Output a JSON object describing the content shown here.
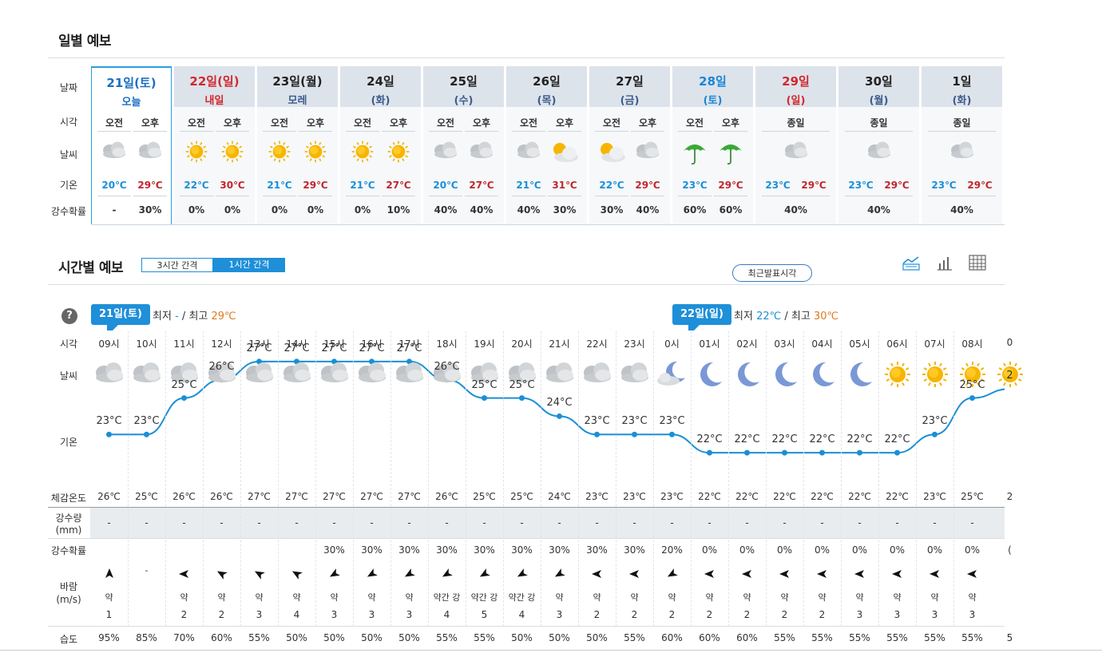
{
  "daily": {
    "title": "일별 예보",
    "labels": {
      "date": "날짜",
      "time": "시각",
      "weather": "날씨",
      "temp": "기온",
      "precip": "강수확률"
    },
    "am": "오전",
    "pm": "오후",
    "allday": "종일",
    "days": [
      {
        "name": "21일(토)",
        "sub": "오늘",
        "color": "#1a6fc4",
        "subcolor": "#1a6fc4",
        "split": true,
        "icons": [
          "cloud",
          "cloud"
        ],
        "lo": "20℃",
        "hi": "29℃",
        "p": [
          "-",
          "30%"
        ],
        "today": true
      },
      {
        "name": "22일(일)",
        "sub": "내일",
        "color": "#d2282e",
        "subcolor": "#d2282e",
        "split": true,
        "icons": [
          "sun",
          "sun"
        ],
        "lo": "22℃",
        "hi": "30℃",
        "p": [
          "0%",
          "0%"
        ]
      },
      {
        "name": "23일(월)",
        "sub": "모레",
        "color": "#222",
        "subcolor": "#3b5b8c",
        "split": true,
        "icons": [
          "sun",
          "sun"
        ],
        "lo": "21℃",
        "hi": "29℃",
        "p": [
          "0%",
          "0%"
        ]
      },
      {
        "name": "24일",
        "sub": "(화)",
        "color": "#222",
        "subcolor": "#3b5b8c",
        "split": true,
        "icons": [
          "sun",
          "sun"
        ],
        "lo": "21℃",
        "hi": "27℃",
        "p": [
          "0%",
          "10%"
        ]
      },
      {
        "name": "25일",
        "sub": "(수)",
        "color": "#222",
        "subcolor": "#3b5b8c",
        "split": true,
        "icons": [
          "cloud",
          "cloud"
        ],
        "lo": "20℃",
        "hi": "27℃",
        "p": [
          "40%",
          "40%"
        ]
      },
      {
        "name": "26일",
        "sub": "(목)",
        "color": "#222",
        "subcolor": "#3b5b8c",
        "split": true,
        "icons": [
          "cloud",
          "suncloud"
        ],
        "lo": "21℃",
        "hi": "31℃",
        "p": [
          "40%",
          "30%"
        ]
      },
      {
        "name": "27일",
        "sub": "(금)",
        "color": "#222",
        "subcolor": "#3b5b8c",
        "split": true,
        "icons": [
          "suncloud",
          "cloud"
        ],
        "lo": "22℃",
        "hi": "29℃",
        "p": [
          "30%",
          "40%"
        ]
      },
      {
        "name": "28일",
        "sub": "(토)",
        "color": "#1a86d6",
        "subcolor": "#1a86d6",
        "split": true,
        "icons": [
          "umbrella",
          "umbrella"
        ],
        "lo": "23℃",
        "hi": "29℃",
        "p": [
          "60%",
          "60%"
        ]
      },
      {
        "name": "29일",
        "sub": "(일)",
        "color": "#d2282e",
        "subcolor": "#d2282e",
        "split": false,
        "icons": [
          "cloud"
        ],
        "lo": "23℃",
        "hi": "29℃",
        "p": [
          "40%"
        ]
      },
      {
        "name": "30일",
        "sub": "(월)",
        "color": "#222",
        "subcolor": "#3b5b8c",
        "split": false,
        "icons": [
          "cloud"
        ],
        "lo": "23℃",
        "hi": "29℃",
        "p": [
          "40%"
        ]
      },
      {
        "name": "1일",
        "sub": "(화)",
        "color": "#222",
        "subcolor": "#3b5b8c",
        "split": false,
        "icons": [
          "cloud"
        ],
        "lo": "23℃",
        "hi": "29℃",
        "p": [
          "40%"
        ]
      }
    ]
  },
  "hourly": {
    "title": "시간별 예보",
    "interval3": "3시간 간격",
    "interval1": "1시간 간격",
    "latest": "최근발표시각",
    "help": "?",
    "labels": {
      "time": "시각",
      "weather": "날씨",
      "temp": "기온",
      "feel": "체감온도",
      "rain": "강수량",
      "rain_unit": "(mm)",
      "prob": "강수확률",
      "wind": "바람",
      "wind_unit": "(m/s)",
      "humid": "습도"
    },
    "day1": {
      "tag": "21일(토)",
      "min_label": "최저",
      "min": "-",
      "sep": "/",
      "max_label": "최고",
      "max": "29℃"
    },
    "day2": {
      "tag": "22일(일)",
      "min_label": "최저",
      "min": "22℃",
      "sep": "/",
      "max_label": "최고",
      "max": "30℃"
    },
    "hours": [
      {
        "t": "09시",
        "icon": "cloud",
        "temp": 23,
        "tl": "23°C",
        "feel": "26℃",
        "rain": "-",
        "prob": "",
        "dir": 180,
        "ws": "약",
        "wv": "1",
        "hum": "95%"
      },
      {
        "t": "10시",
        "icon": "cloud",
        "temp": 23,
        "tl": "23°C",
        "feel": "25℃",
        "rain": "-",
        "prob": "",
        "dir": null,
        "ws": "",
        "wv": "",
        "hum": "85%"
      },
      {
        "t": "11시",
        "icon": "cloud",
        "temp": 25,
        "tl": "25°C",
        "feel": "26℃",
        "rain": "-",
        "prob": "",
        "dir": 90,
        "ws": "약",
        "wv": "2",
        "hum": "70%"
      },
      {
        "t": "12시",
        "icon": "cloud",
        "temp": 26,
        "tl": "26°C",
        "feel": "26℃",
        "rain": "-",
        "prob": "",
        "dir": 120,
        "ws": "약",
        "wv": "2",
        "hum": "60%"
      },
      {
        "t": "13시",
        "icon": "cloud",
        "temp": 27,
        "tl": "27°C",
        "feel": "27℃",
        "rain": "-",
        "prob": "",
        "dir": 120,
        "ws": "약",
        "wv": "3",
        "hum": "55%"
      },
      {
        "t": "14시",
        "icon": "cloud",
        "temp": 27,
        "tl": "27°C",
        "feel": "27℃",
        "rain": "-",
        "prob": "",
        "dir": 120,
        "ws": "약",
        "wv": "4",
        "hum": "50%"
      },
      {
        "t": "15시",
        "icon": "cloud",
        "temp": 27,
        "tl": "27°C",
        "feel": "27℃",
        "rain": "-",
        "prob": "30%",
        "dir": 60,
        "ws": "약",
        "wv": "3",
        "hum": "50%"
      },
      {
        "t": "16시",
        "icon": "cloud",
        "temp": 27,
        "tl": "27°C",
        "feel": "27℃",
        "rain": "-",
        "prob": "30%",
        "dir": 60,
        "ws": "약",
        "wv": "3",
        "hum": "50%"
      },
      {
        "t": "17시",
        "icon": "cloud",
        "temp": 27,
        "tl": "27°C",
        "feel": "27℃",
        "rain": "-",
        "prob": "30%",
        "dir": 60,
        "ws": "약",
        "wv": "3",
        "hum": "50%"
      },
      {
        "t": "18시",
        "icon": "cloud",
        "temp": 26,
        "tl": "26°C",
        "feel": "26℃",
        "rain": "-",
        "prob": "30%",
        "dir": 60,
        "ws": "약간 강",
        "wv": "4",
        "hum": "55%"
      },
      {
        "t": "19시",
        "icon": "cloud",
        "temp": 25,
        "tl": "25°C",
        "feel": "25℃",
        "rain": "-",
        "prob": "30%",
        "dir": 60,
        "ws": "약간 강",
        "wv": "5",
        "hum": "55%"
      },
      {
        "t": "20시",
        "icon": "cloud",
        "temp": 25,
        "tl": "25°C",
        "feel": "25℃",
        "rain": "-",
        "prob": "30%",
        "dir": 60,
        "ws": "약간 강",
        "wv": "4",
        "hum": "50%"
      },
      {
        "t": "21시",
        "icon": "cloud",
        "temp": 24,
        "tl": "24°C",
        "feel": "24℃",
        "rain": "-",
        "prob": "30%",
        "dir": 60,
        "ws": "약",
        "wv": "3",
        "hum": "50%"
      },
      {
        "t": "22시",
        "icon": "cloud",
        "temp": 23,
        "tl": "23°C",
        "feel": "23℃",
        "rain": "-",
        "prob": "30%",
        "dir": 90,
        "ws": "약",
        "wv": "2",
        "hum": "50%"
      },
      {
        "t": "23시",
        "icon": "cloud",
        "temp": 23,
        "tl": "23°C",
        "feel": "23℃",
        "rain": "-",
        "prob": "30%",
        "dir": 90,
        "ws": "약",
        "wv": "2",
        "hum": "55%"
      },
      {
        "t": "0시",
        "icon": "mooncloud",
        "temp": 23,
        "tl": "23°C",
        "feel": "23℃",
        "rain": "-",
        "prob": "20%",
        "dir": 60,
        "ws": "약",
        "wv": "2",
        "hum": "60%"
      },
      {
        "t": "01시",
        "icon": "moon",
        "temp": 22,
        "tl": "22°C",
        "feel": "22℃",
        "rain": "-",
        "prob": "0%",
        "dir": 90,
        "ws": "약",
        "wv": "2",
        "hum": "60%"
      },
      {
        "t": "02시",
        "icon": "moon",
        "temp": 22,
        "tl": "22°C",
        "feel": "22℃",
        "rain": "-",
        "prob": "0%",
        "dir": 90,
        "ws": "약",
        "wv": "2",
        "hum": "60%"
      },
      {
        "t": "03시",
        "icon": "moon",
        "temp": 22,
        "tl": "22°C",
        "feel": "22℃",
        "rain": "-",
        "prob": "0%",
        "dir": 90,
        "ws": "약",
        "wv": "2",
        "hum": "55%"
      },
      {
        "t": "04시",
        "icon": "moon",
        "temp": 22,
        "tl": "22°C",
        "feel": "22℃",
        "rain": "-",
        "prob": "0%",
        "dir": 90,
        "ws": "약",
        "wv": "2",
        "hum": "55%"
      },
      {
        "t": "05시",
        "icon": "moon",
        "temp": 22,
        "tl": "22°C",
        "feel": "22℃",
        "rain": "-",
        "prob": "0%",
        "dir": 90,
        "ws": "약",
        "wv": "3",
        "hum": "55%"
      },
      {
        "t": "06시",
        "icon": "sun",
        "temp": 22,
        "tl": "22°C",
        "feel": "22℃",
        "rain": "-",
        "prob": "0%",
        "dir": 90,
        "ws": "약",
        "wv": "3",
        "hum": "55%"
      },
      {
        "t": "07시",
        "icon": "sun",
        "temp": 23,
        "tl": "23°C",
        "feel": "23℃",
        "rain": "-",
        "prob": "0%",
        "dir": 90,
        "ws": "약",
        "wv": "3",
        "hum": "55%"
      },
      {
        "t": "08시",
        "icon": "sun",
        "temp": 25,
        "tl": "25°C",
        "feel": "25℃",
        "rain": "-",
        "prob": "0%",
        "dir": 90,
        "ws": "약",
        "wv": "3",
        "hum": "55%"
      },
      {
        "t": "0",
        "icon": "sun",
        "temp": 25.5,
        "tl": "2",
        "feel": "2",
        "rain": "",
        "prob": "(",
        "dir": null,
        "ws": "",
        "wv": "",
        "hum": "5"
      }
    ]
  },
  "colors": {
    "accent": "#1e8fd8",
    "hot": "#d2282e",
    "line": "#1a8fd6"
  }
}
